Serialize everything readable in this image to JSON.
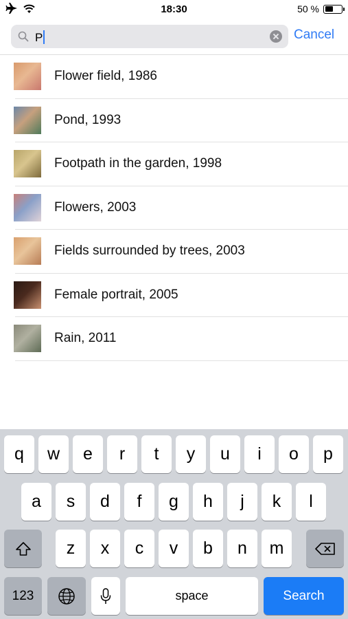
{
  "status_bar": {
    "time": "18:30",
    "battery_percent_label": "50 %",
    "battery_level": 0.5
  },
  "search": {
    "query": "P",
    "cancel_label": "Cancel"
  },
  "results": [
    {
      "title": "Flower field, 1986",
      "thumb_colors": [
        "#d99a6c",
        "#c9786e",
        "#e8b892"
      ]
    },
    {
      "title": "Pond, 1993",
      "thumb_colors": [
        "#6b87a8",
        "#4f7a5a",
        "#c6a07e"
      ]
    },
    {
      "title": "Footpath in the garden, 1998",
      "thumb_colors": [
        "#b8a56a",
        "#7d6a3b",
        "#d8c58e"
      ]
    },
    {
      "title": "Flowers, 2003",
      "thumb_colors": [
        "#c8807a",
        "#e0d2d8",
        "#8aa0c8"
      ]
    },
    {
      "title": "Fields surrounded by trees, 2003",
      "thumb_colors": [
        "#d9a06e",
        "#b77c55",
        "#e8c49a"
      ]
    },
    {
      "title": "Female portrait, 2005",
      "thumb_colors": [
        "#2a1a14",
        "#c89070",
        "#4a2a1e"
      ]
    },
    {
      "title": "Rain, 2011",
      "thumb_colors": [
        "#8a8a7a",
        "#5e6b55",
        "#b0b0a0"
      ]
    }
  ],
  "keyboard": {
    "row1": [
      "q",
      "w",
      "e",
      "r",
      "t",
      "y",
      "u",
      "i",
      "o",
      "p"
    ],
    "row2": [
      "a",
      "s",
      "d",
      "f",
      "g",
      "h",
      "j",
      "k",
      "l"
    ],
    "row3": [
      "z",
      "x",
      "c",
      "v",
      "b",
      "n",
      "m"
    ],
    "numbers_label": "123",
    "space_label": "space",
    "search_label": "Search"
  }
}
